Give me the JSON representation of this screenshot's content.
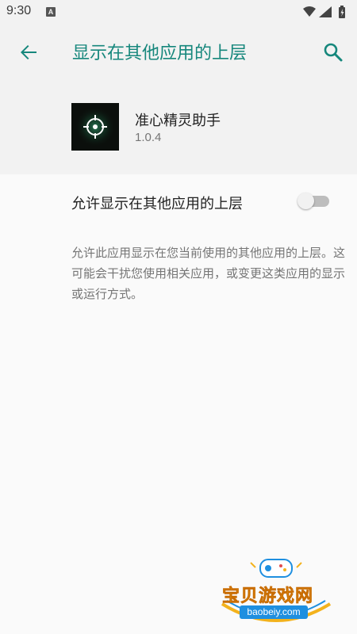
{
  "status_bar": {
    "time": "9:30",
    "notification_badge": "A",
    "icons": [
      "wifi-icon",
      "signal-icon",
      "battery-icon"
    ]
  },
  "app_bar": {
    "title": "显示在其他应用的上层",
    "back_icon": "arrow-left-icon",
    "search_icon": "search-icon"
  },
  "app_info": {
    "name": "准心精灵助手",
    "version": "1.0.4"
  },
  "permission": {
    "label": "允许显示在其他应用的上层",
    "enabled": false,
    "description": "允许此应用显示在您当前使用的其他应用的上层。这可能会干扰您使用相关应用，或变更这类应用的显示或运行方式。"
  },
  "watermark": {
    "text": "宝贝游戏网",
    "url": "baobeiy.com"
  },
  "colors": {
    "accent": "#16877c",
    "header_bg": "#f2f2f2",
    "page_bg": "#fafafa",
    "toggle_off_track": "#bdbdbd"
  }
}
